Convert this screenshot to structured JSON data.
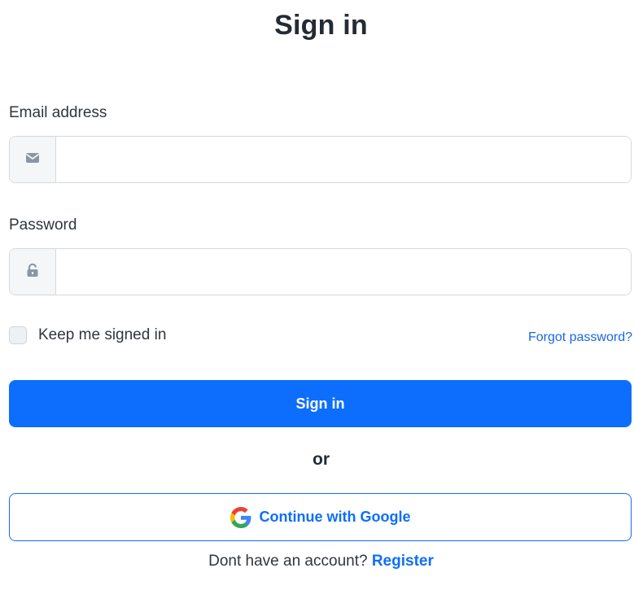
{
  "page": {
    "title": "Sign in"
  },
  "form": {
    "email": {
      "label": "Email address",
      "value": "",
      "placeholder": "",
      "icon": "envelope-icon"
    },
    "password": {
      "label": "Password",
      "value": "",
      "placeholder": "",
      "icon": "lock-icon"
    },
    "remember": {
      "label": "Keep me signed in",
      "checked": false
    },
    "forgot_label": "Forgot password?",
    "submit_label": "Sign in"
  },
  "divider": {
    "label": "or"
  },
  "google": {
    "label": "Continue with Google",
    "icon": "google-icon"
  },
  "footer": {
    "prompt": "Dont have an account?",
    "link_label": "Register"
  },
  "colors": {
    "primary": "#0d6efd",
    "link": "#1769e6",
    "text": "#242b35",
    "border": "#d5d9de",
    "addon_bg": "#f5f6f8",
    "google_blue": "#4285F4",
    "google_red": "#EA4335",
    "google_yellow": "#FBBC05",
    "google_green": "#34A853"
  }
}
